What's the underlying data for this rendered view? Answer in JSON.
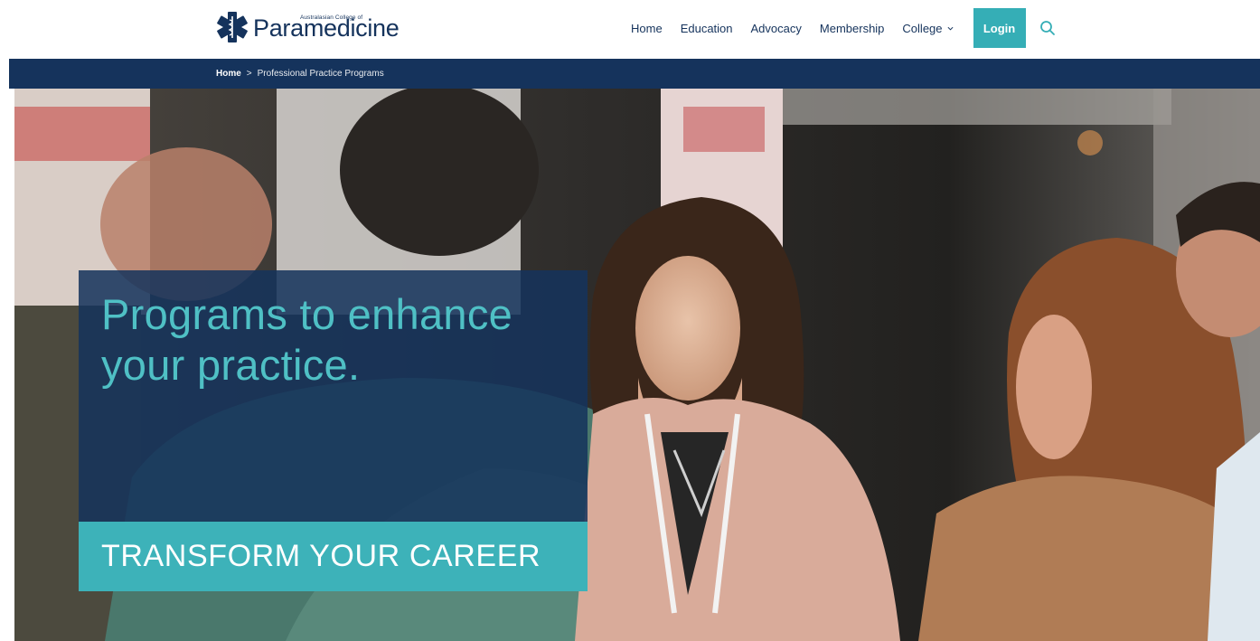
{
  "header": {
    "logo": {
      "small_text": "Australasian College of",
      "main_text": "Paramedicine"
    },
    "nav": [
      {
        "label": "Home"
      },
      {
        "label": "Education"
      },
      {
        "label": "Advocacy"
      },
      {
        "label": "Membership"
      },
      {
        "label": "College",
        "has_dropdown": true
      }
    ],
    "login_label": "Login",
    "search_icon": "search-icon"
  },
  "breadcrumb": {
    "home": "Home",
    "separator": ">",
    "current": "Professional Practice Programs"
  },
  "hero": {
    "title": "Programs to enhance your practice.",
    "cta": "TRANSFORM YOUR CAREER"
  },
  "colors": {
    "navy": "#15335c",
    "teal": "#35aeb6",
    "teal_text": "#4fc0c5",
    "white": "#ffffff"
  }
}
